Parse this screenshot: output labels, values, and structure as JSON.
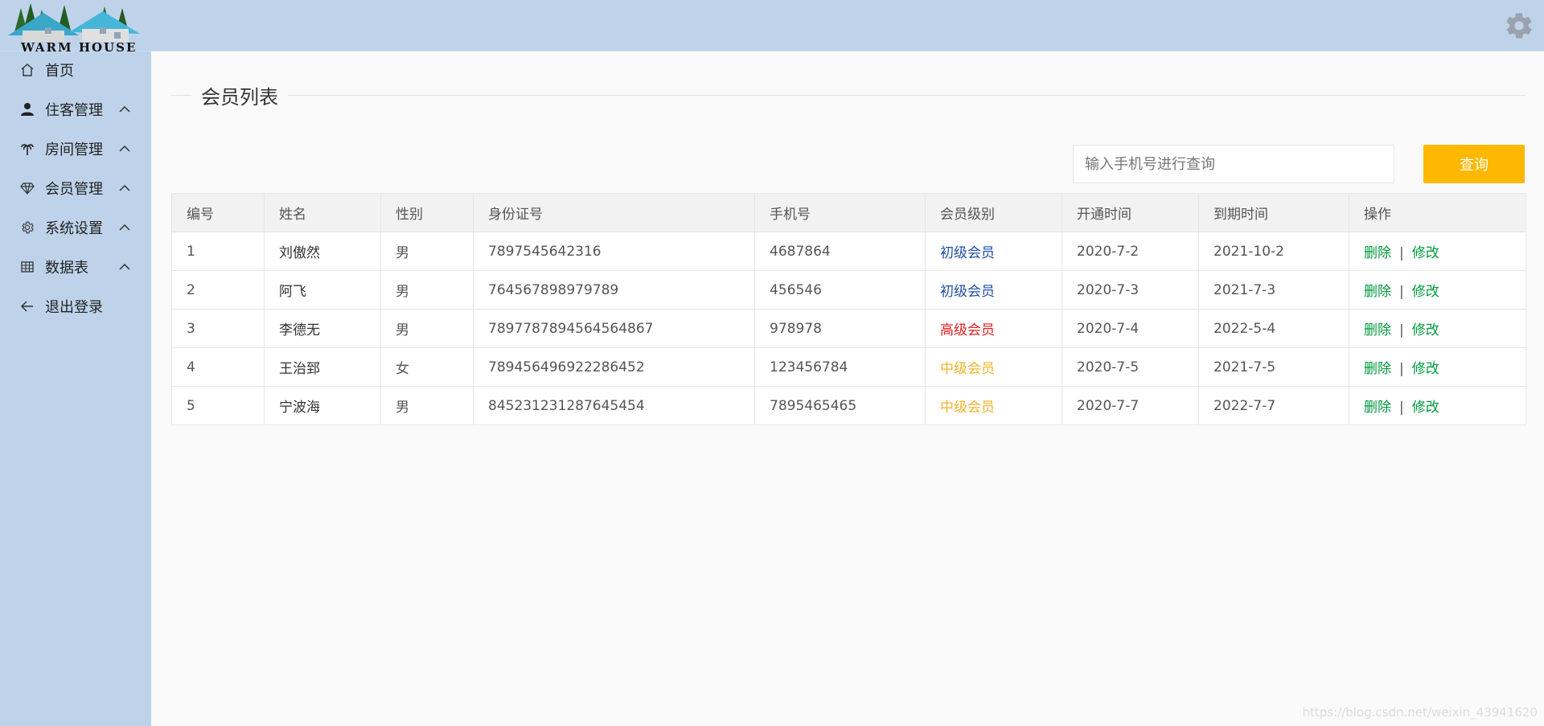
{
  "brand": {
    "logo_text": "WARM HOUSE"
  },
  "sidebar": {
    "items": [
      {
        "label": "首页",
        "icon": "home-icon",
        "expandable": false
      },
      {
        "label": "住客管理",
        "icon": "user-icon",
        "expandable": true
      },
      {
        "label": "房间管理",
        "icon": "palm-tree-icon",
        "expandable": true
      },
      {
        "label": "会员管理",
        "icon": "diamond-icon",
        "expandable": true
      },
      {
        "label": "系统设置",
        "icon": "gear-icon",
        "expandable": true
      },
      {
        "label": "数据表",
        "icon": "table-icon",
        "expandable": true
      },
      {
        "label": "退出登录",
        "icon": "arrow-left-icon",
        "expandable": false
      }
    ]
  },
  "header": {
    "settings_icon": "gear-icon"
  },
  "main": {
    "title": "会员列表",
    "search": {
      "placeholder": "输入手机号进行查询",
      "value": ""
    },
    "search_button": "查询",
    "table": {
      "columns": [
        "编号",
        "姓名",
        "性别",
        "身份证号",
        "手机号",
        "会员级别",
        "开通时间",
        "到期时间",
        "操作"
      ],
      "rows": [
        {
          "id": "1",
          "name": "刘傲然",
          "gender": "男",
          "id_card": "7897545642316",
          "phone": "4687864",
          "level": "初级会员",
          "level_color": "#1e4fa8",
          "start": "2020-7-2",
          "end": "2021-10-2"
        },
        {
          "id": "2",
          "name": "阿飞",
          "gender": "男",
          "id_card": "764567898979789",
          "phone": "456546",
          "level": "初级会员",
          "level_color": "#1e4fa8",
          "start": "2020-7-3",
          "end": "2021-7-3"
        },
        {
          "id": "3",
          "name": "李德无",
          "gender": "男",
          "id_card": "7897787894564564867",
          "phone": "978978",
          "level": "高级会员",
          "level_color": "#e02020",
          "start": "2020-7-4",
          "end": "2022-5-4"
        },
        {
          "id": "4",
          "name": "王治郅",
          "gender": "女",
          "id_card": "789456496922286452",
          "phone": "123456784",
          "level": "中级会员",
          "level_color": "#f0b429",
          "start": "2020-7-5",
          "end": "2021-7-5"
        },
        {
          "id": "5",
          "name": "宁波海",
          "gender": "男",
          "id_card": "845231231287645454",
          "phone": "7895465465",
          "level": "中级会员",
          "level_color": "#f0b429",
          "start": "2020-7-7",
          "end": "2022-7-7"
        }
      ],
      "actions": {
        "delete": "删除",
        "separator": "|",
        "edit": "修改"
      }
    }
  },
  "colors": {
    "sidebar_bg": "#bed3ea",
    "accent_button": "#ffb800",
    "action_link": "#009a3e"
  },
  "watermark": "https://blog.csdn.net/weixin_43941620"
}
